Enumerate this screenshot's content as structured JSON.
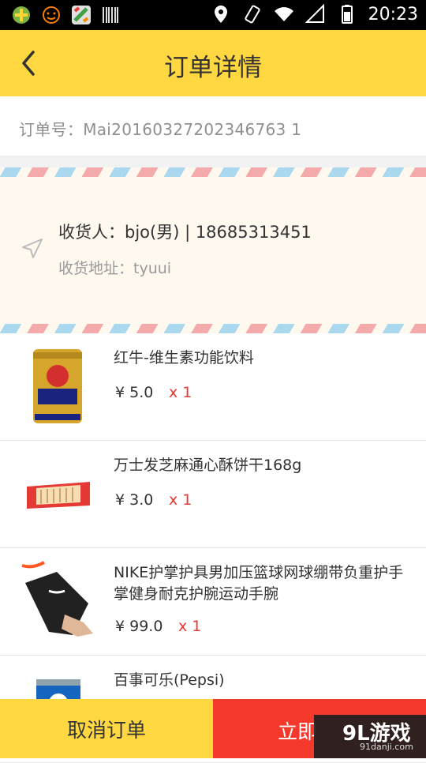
{
  "status_bar": {
    "time": "20:23"
  },
  "header": {
    "title": "订单详情"
  },
  "order": {
    "number_text": "订单号：Mai20160327202346763 1"
  },
  "address": {
    "receiver_text": "收货人：bjo(男) | 18685313451",
    "address_text": "收货地址：tyuui"
  },
  "items": [
    {
      "name": "红牛-维生素功能饮料",
      "price": "¥ 5.0",
      "qty": "x 1"
    },
    {
      "name": "万士发芝麻通心酥饼干168g",
      "price": "¥ 3.0",
      "qty": "x 1"
    },
    {
      "name": "NIKE护掌护具男加压篮球网球绷带负重护手掌健身耐克护腕运动手腕",
      "price": "¥ 99.0",
      "qty": "x 1"
    },
    {
      "name": "百事可乐(Pepsi)",
      "price": "",
      "qty": ""
    }
  ],
  "footer": {
    "cancel_label": "取消订单",
    "buy_label": "立即"
  },
  "watermark": {
    "brand": "9L游戏",
    "site": "91danji.com"
  },
  "colors": {
    "accent": "#ffd740",
    "danger": "#f4392c",
    "qty": "#e53935"
  }
}
